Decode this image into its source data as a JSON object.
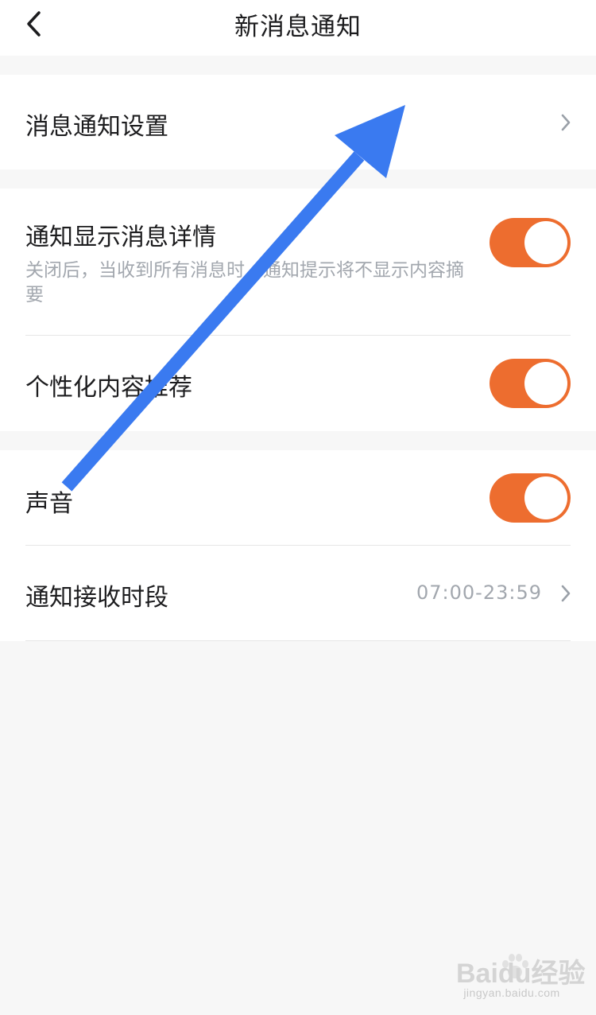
{
  "header": {
    "title": "新消息通知"
  },
  "settings": {
    "message_notification": {
      "label": "消息通知设置"
    },
    "show_details": {
      "label": "通知显示消息详情",
      "description": "关闭后，当收到所有消息时，通知提示将不显示内容摘要",
      "enabled": true
    },
    "personalized": {
      "label": "个性化内容推荐",
      "enabled": true
    },
    "sound": {
      "label": "声音",
      "enabled": true
    },
    "receive_period": {
      "label": "通知接收时段",
      "value": "07:00-23:59"
    }
  },
  "watermark": {
    "logo_text": "Baidu经验",
    "domain": "jingyan.baidu.com"
  },
  "colors": {
    "toggle_on": "#ed6d2f",
    "arrow": "#3a7af0",
    "secondary_text": "#a2a7ae"
  }
}
